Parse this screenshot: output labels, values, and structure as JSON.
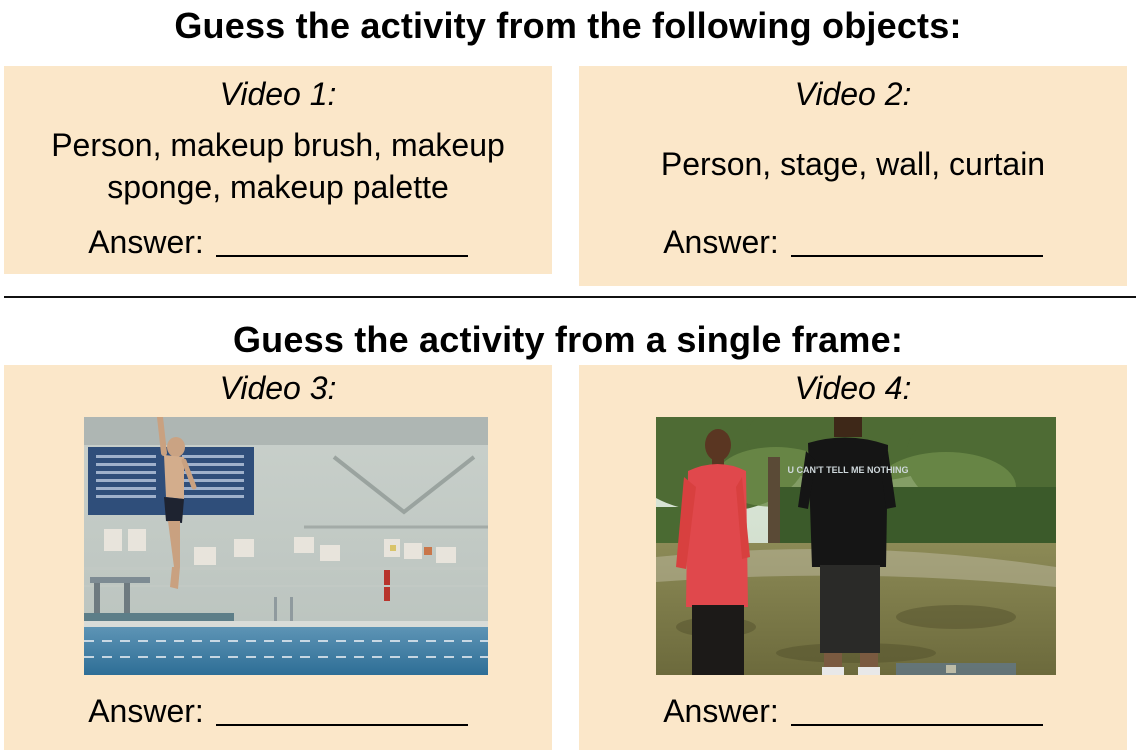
{
  "sections": {
    "objects_heading": "Guess the activity from the following objects:",
    "frame_heading": "Guess the activity from a single frame:"
  },
  "videos": [
    {
      "label": "Video 1:",
      "objects": "Person, makeup brush, makeup sponge, makeup palette",
      "answer_label": "Answer:"
    },
    {
      "label": "Video 2:",
      "objects": "Person, stage, wall, curtain",
      "answer_label": "Answer:"
    },
    {
      "label": "Video 3:",
      "image": "diver-jumping-into-indoor-pool",
      "answer_label": "Answer:"
    },
    {
      "label": "Video 4:",
      "image": "two-men-standing-in-park",
      "shirt_text": "U CAN'T TELL ME NOTHING",
      "answer_label": "Answer:"
    }
  ],
  "colors": {
    "panel_background": "#fbe7c9",
    "divider": "#111111"
  }
}
